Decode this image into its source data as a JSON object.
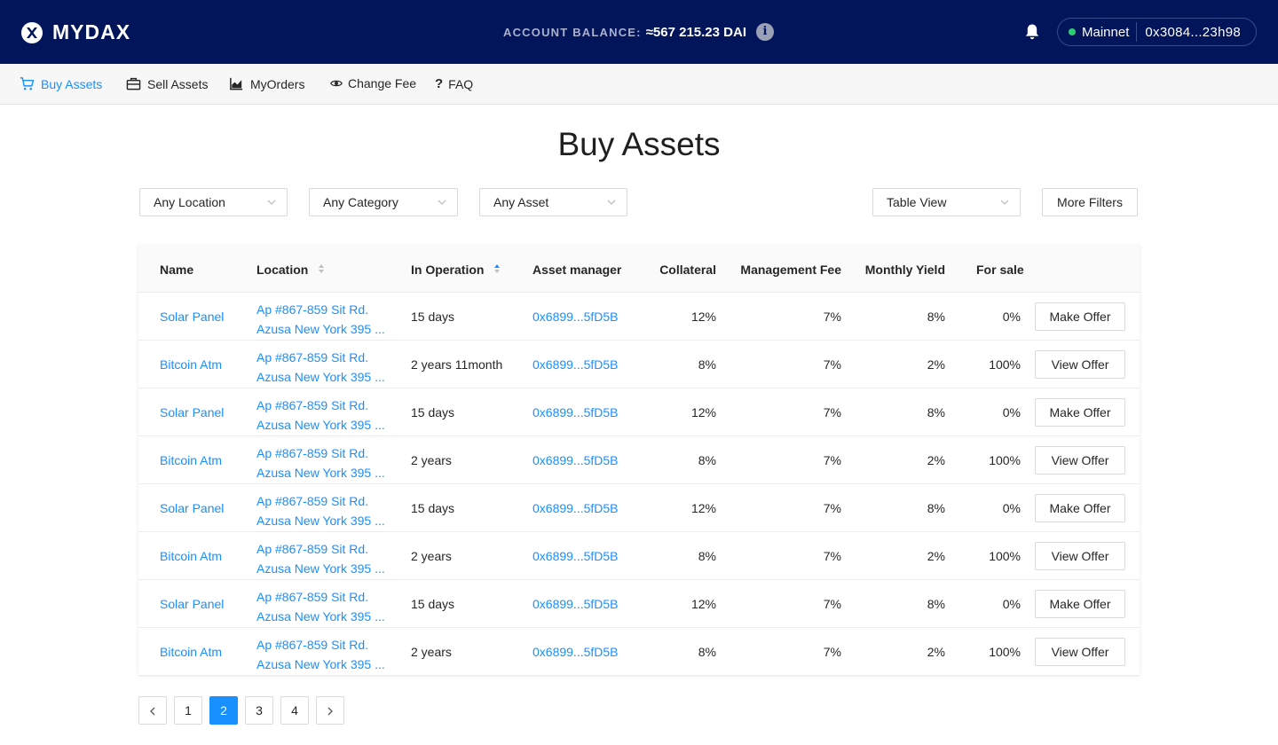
{
  "header": {
    "brand": "MYDAX",
    "balance_label": "ACCOUNT BALANCE:",
    "balance_value": "≈567 215.23 DAI",
    "info_glyph": "i",
    "network": "Mainnet",
    "address": "0x3084...23h98",
    "network_status_color": "#2ecc71"
  },
  "nav": [
    {
      "label": "Buy Assets",
      "icon": "cart-icon",
      "active": true
    },
    {
      "label": "Sell Assets",
      "icon": "briefcase-icon",
      "active": false
    },
    {
      "label": "MyOrders",
      "icon": "chart-icon",
      "active": false
    },
    {
      "label": "Change Fee",
      "icon": "eye-icon",
      "active": false
    },
    {
      "label": "FAQ",
      "icon": "question-icon",
      "active": false
    }
  ],
  "page_title": "Buy Assets",
  "filters": {
    "location": "Any Location",
    "category": "Any Category",
    "asset": "Any Asset",
    "view": "Table View",
    "more": "More Filters"
  },
  "table": {
    "columns": [
      "Name",
      "Location",
      "In Operation",
      "Asset manager",
      "Collateral",
      "Management Fee",
      "Monthly Yield",
      "For sale"
    ],
    "sorted_column": "In Operation",
    "rows": [
      {
        "name": "Solar Panel",
        "loc1": "Ap #867-859 Sit Rd.",
        "loc2": "Azusa New York 395 ...",
        "op": "15 days",
        "mgr": "0x6899...5fD5B",
        "col": "12%",
        "fee": "7%",
        "yield": "8%",
        "sale": "0%",
        "action": "Make Offer"
      },
      {
        "name": "Bitcoin Atm",
        "loc1": "Ap #867-859 Sit Rd.",
        "loc2": "Azusa New York 395 ...",
        "op": "2 years 11month",
        "mgr": "0x6899...5fD5B",
        "col": "8%",
        "fee": "7%",
        "yield": "2%",
        "sale": "100%",
        "action": "View Offer"
      },
      {
        "name": "Solar Panel",
        "loc1": "Ap #867-859 Sit Rd.",
        "loc2": "Azusa New York 395 ...",
        "op": "15 days",
        "mgr": "0x6899...5fD5B",
        "col": "12%",
        "fee": "7%",
        "yield": "8%",
        "sale": "0%",
        "action": "Make Offer"
      },
      {
        "name": "Bitcoin Atm",
        "loc1": "Ap #867-859 Sit Rd.",
        "loc2": "Azusa New York 395 ...",
        "op": "2 years",
        "mgr": "0x6899...5fD5B",
        "col": "8%",
        "fee": "7%",
        "yield": "2%",
        "sale": "100%",
        "action": "View Offer"
      },
      {
        "name": "Solar Panel",
        "loc1": "Ap #867-859 Sit Rd.",
        "loc2": "Azusa New York 395 ...",
        "op": "15 days",
        "mgr": "0x6899...5fD5B",
        "col": "12%",
        "fee": "7%",
        "yield": "8%",
        "sale": "0%",
        "action": "Make Offer"
      },
      {
        "name": "Bitcoin Atm",
        "loc1": "Ap #867-859 Sit Rd.",
        "loc2": "Azusa New York 395 ...",
        "op": "2 years",
        "mgr": "0x6899...5fD5B",
        "col": "8%",
        "fee": "7%",
        "yield": "2%",
        "sale": "100%",
        "action": "View Offer"
      },
      {
        "name": "Solar Panel",
        "loc1": "Ap #867-859 Sit Rd.",
        "loc2": "Azusa New York 395 ...",
        "op": "15 days",
        "mgr": "0x6899...5fD5B",
        "col": "12%",
        "fee": "7%",
        "yield": "8%",
        "sale": "0%",
        "action": "Make Offer"
      },
      {
        "name": "Bitcoin Atm",
        "loc1": "Ap #867-859 Sit Rd.",
        "loc2": "Azusa New York 395 ...",
        "op": "2 years",
        "mgr": "0x6899...5fD5B",
        "col": "8%",
        "fee": "7%",
        "yield": "2%",
        "sale": "100%",
        "action": "View Offer"
      }
    ]
  },
  "pagination": {
    "pages": [
      "1",
      "2",
      "3",
      "4"
    ],
    "current": "2"
  },
  "colors": {
    "header_bg": "#02155b",
    "accent": "#1890ff"
  }
}
